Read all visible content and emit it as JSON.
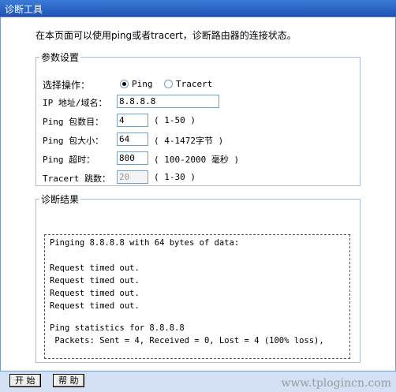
{
  "window": {
    "title": "诊断工具"
  },
  "description": "在本页面可以使用ping或者tracert，诊断路由器的连接状态。",
  "params": {
    "legend": "参数设置",
    "operation_label": "选择操作：",
    "options": [
      "Ping",
      "Tracert"
    ],
    "selected": "Ping",
    "ip_label": "IP 地址/域名：",
    "ip_value": "8.8.8.8",
    "count_label": "Ping 包数目：",
    "count_value": "4",
    "count_hint": "( 1-50 )",
    "size_label": "Ping 包大小：",
    "size_value": "64",
    "size_hint": "( 4-1472字节 )",
    "timeout_label": "Ping 超时：",
    "timeout_value": "800",
    "timeout_hint": "( 100-2000 毫秒 )",
    "tracert_label": "Tracert 跳数：",
    "tracert_value": "20",
    "tracert_hint": "( 1-30 )"
  },
  "result": {
    "legend": "诊断结果",
    "lines": [
      "Pinging 8.8.8.8 with 64 bytes of data:",
      "",
      "Request timed out.",
      "Request timed out.",
      "Request timed out.",
      "Request timed out.",
      "",
      "Ping statistics for 8.8.8.8",
      " Packets: Sent = 4, Received = 0, Lost = 4 (100% loss),"
    ]
  },
  "buttons": {
    "start": "开 始",
    "help": "帮 助"
  },
  "watermark": "www.tplogincn.com"
}
